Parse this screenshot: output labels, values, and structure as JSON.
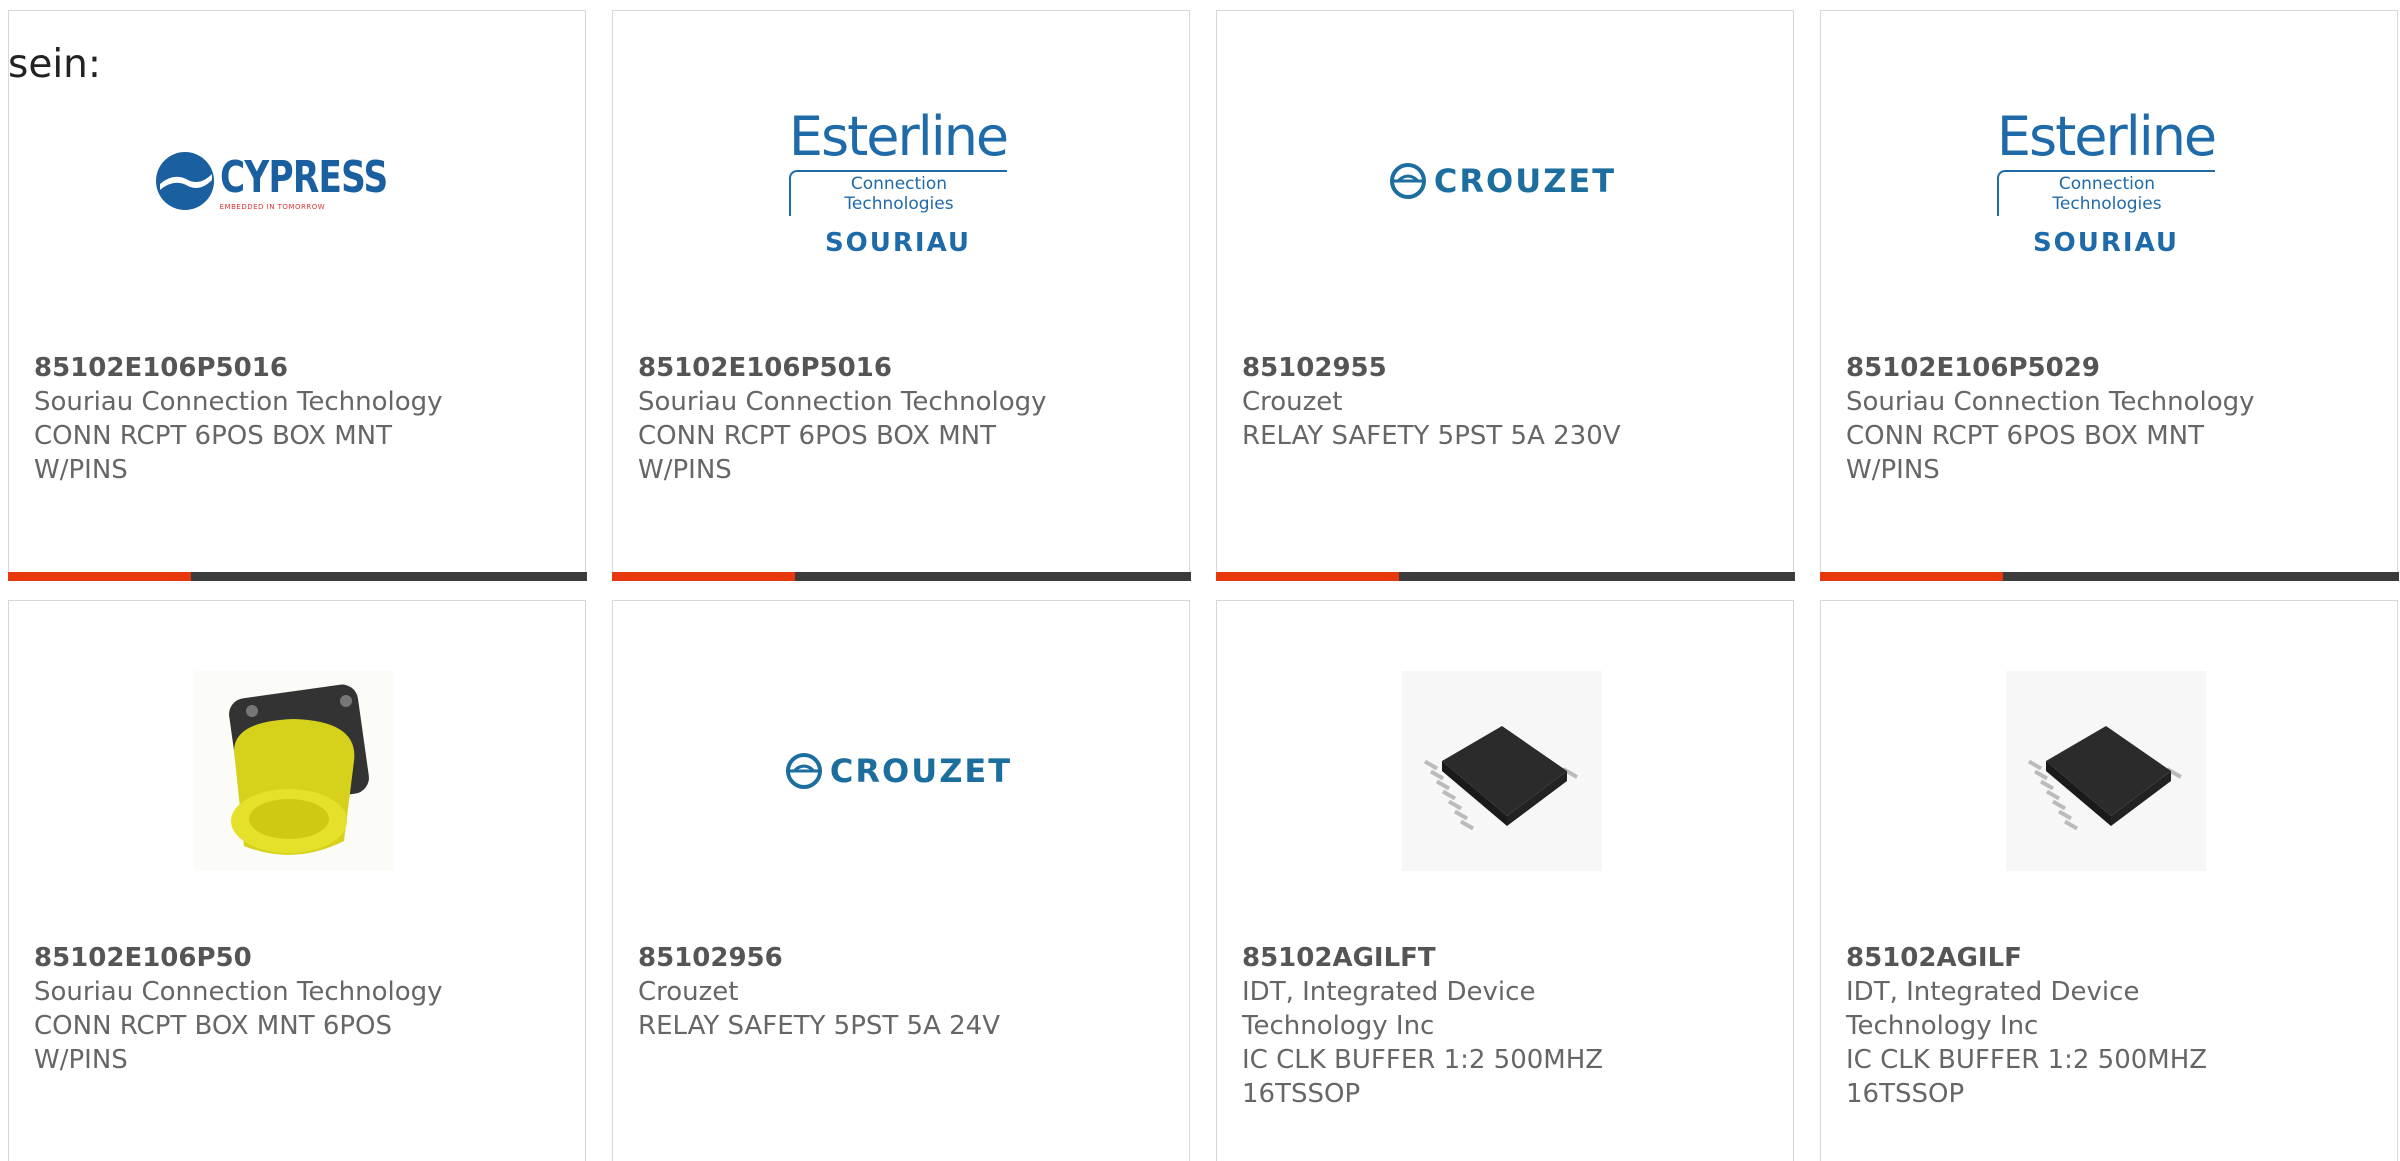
{
  "intro_text": "sein:",
  "colors": {
    "accent": "#e8380d",
    "bar": "#3c3c3c",
    "brand_blue": "#1f6aa8"
  },
  "cards": [
    {
      "part_number": "85102E106P5016",
      "manufacturer": "Souriau Connection Technology",
      "description_lines": [
        "CONN RCPT 6POS BOX MNT",
        "W/PINS"
      ],
      "image": "cypress-logo",
      "logo_text": "CYPRESS",
      "logo_tagline": "EMBEDDED IN TOMORROW"
    },
    {
      "part_number": "85102E106P5016",
      "manufacturer": "Souriau Connection Technology",
      "description_lines": [
        "CONN RCPT 6POS BOX MNT",
        "W/PINS"
      ],
      "image": "esterline-souriau-logo",
      "logo_text": "Esterline",
      "logo_sub": "Connection Technologies",
      "logo_brand": "SOURIAU"
    },
    {
      "part_number": "85102955",
      "manufacturer": "Crouzet",
      "description_lines": [
        "RELAY SAFETY 5PST 5A 230V"
      ],
      "image": "crouzet-logo",
      "logo_text": "CROUZET"
    },
    {
      "part_number": "85102E106P5029",
      "manufacturer": "Souriau Connection Technology",
      "description_lines": [
        "CONN RCPT 6POS BOX MNT",
        "W/PINS"
      ],
      "image": "esterline-souriau-logo",
      "logo_text": "Esterline",
      "logo_sub": "Connection Technologies",
      "logo_brand": "SOURIAU"
    },
    {
      "part_number": "85102E106P50",
      "manufacturer": "Souriau Connection Technology",
      "description_lines": [
        "CONN RCPT BOX MNT 6POS",
        "W/PINS"
      ],
      "image": "connector-photo"
    },
    {
      "part_number": "85102956",
      "manufacturer": "Crouzet",
      "description_lines": [
        "RELAY SAFETY 5PST 5A 24V"
      ],
      "image": "crouzet-logo",
      "logo_text": "CROUZET"
    },
    {
      "part_number": "85102AGILFT",
      "manufacturer": "IDT, Integrated Device",
      "manufacturer_line2": "Technology Inc",
      "description_lines": [
        "IC CLK BUFFER 1:2 500MHZ",
        "16TSSOP"
      ],
      "image": "ic-chip-photo"
    },
    {
      "part_number": "85102AGILF",
      "manufacturer": "IDT, Integrated Device",
      "manufacturer_line2": "Technology Inc",
      "description_lines": [
        "IC CLK BUFFER 1:2 500MHZ",
        "16TSSOP"
      ],
      "image": "ic-chip-photo"
    }
  ]
}
